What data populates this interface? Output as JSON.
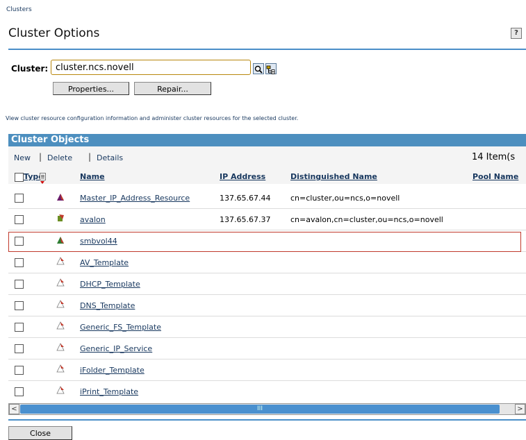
{
  "breadcrumb": "Clusters",
  "page_title": "Cluster Options",
  "help_label": "?",
  "cluster": {
    "label": "Cluster:",
    "value": "cluster.ncs.novell",
    "properties_label": "Properties...",
    "repair_label": "Repair..."
  },
  "description": "View cluster resource configuration information and administer cluster resources for the selected cluster.",
  "panel": {
    "title": "Cluster Objects",
    "actions": {
      "new": "New",
      "delete": "Delete",
      "details": "Details",
      "sep": "|"
    },
    "count": "14 Item(s"
  },
  "columns": {
    "type": "Type",
    "name": "Name",
    "ip": "IP Address",
    "dn": "Distinguished Name",
    "pool": "Pool Name"
  },
  "rows": [
    {
      "icon": "master-ip-resource-icon",
      "name": "Master_IP_Address_Resource",
      "ip": "137.65.67.44",
      "dn": "cn=cluster,ou=ncs,o=novell"
    },
    {
      "icon": "cluster-node-icon",
      "name": "avalon",
      "ip": "137.65.67.37",
      "dn": "cn=avalon,cn=cluster,ou=ncs,o=novell"
    },
    {
      "icon": "resource-icon",
      "name": "smbvol44",
      "ip": "",
      "dn": ""
    },
    {
      "icon": "template-icon",
      "name": "AV_Template",
      "ip": "",
      "dn": ""
    },
    {
      "icon": "template-icon",
      "name": "DHCP_Template",
      "ip": "",
      "dn": ""
    },
    {
      "icon": "template-icon",
      "name": "DNS_Template",
      "ip": "",
      "dn": ""
    },
    {
      "icon": "template-icon",
      "name": "Generic_FS_Template",
      "ip": "",
      "dn": ""
    },
    {
      "icon": "template-icon",
      "name": "Generic_IP_Service",
      "ip": "",
      "dn": ""
    },
    {
      "icon": "template-icon",
      "name": "iFolder_Template",
      "ip": "",
      "dn": ""
    },
    {
      "icon": "template-icon",
      "name": "iPrint_Template",
      "ip": "",
      "dn": ""
    }
  ],
  "scrollbar": {
    "left": "<",
    "right": ">",
    "grip": "III"
  },
  "close_label": "Close"
}
